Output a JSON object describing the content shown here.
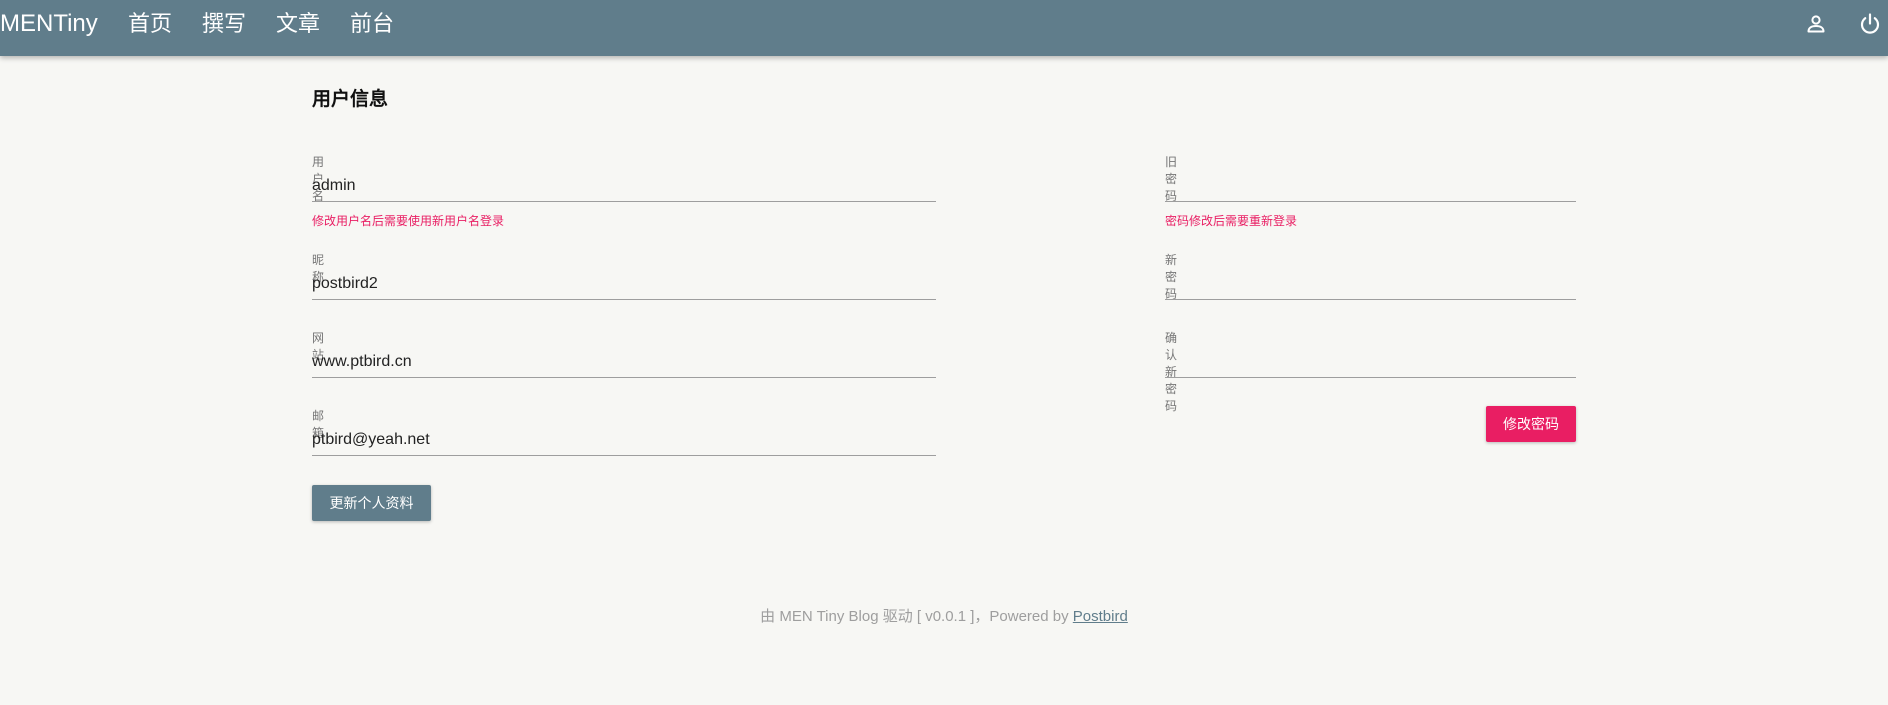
{
  "navbar": {
    "brand": "MENTiny",
    "links": [
      "首页",
      "撰写",
      "文章",
      "前台"
    ],
    "icons": [
      "user-icon",
      "power-icon"
    ]
  },
  "page": {
    "title": "用户信息"
  },
  "profile": {
    "username": {
      "label": "用户名",
      "value": "admin",
      "hint": "修改用户名后需要使用新用户名登录"
    },
    "nickname": {
      "label": "昵称",
      "value": "postbird2"
    },
    "website": {
      "label": "网站",
      "value": "www.ptbird.cn"
    },
    "email": {
      "label": "邮箱",
      "value": "ptbird@yeah.net"
    },
    "submit_label": "更新个人资料"
  },
  "password": {
    "old": {
      "label": "旧密码",
      "value": "",
      "hint": "密码修改后需要重新登录"
    },
    "new": {
      "label": "新密码",
      "value": ""
    },
    "confirm": {
      "label": "确认新密码",
      "value": ""
    },
    "submit_label": "修改密码"
  },
  "footer": {
    "text": "由 MEN Tiny Blog 驱动 [ v0.0.1 ]，Powered by ",
    "link": "Postbird"
  },
  "colors": {
    "primary": "#607d8b",
    "accent": "#e91e63",
    "background": "#f7f7f4"
  }
}
